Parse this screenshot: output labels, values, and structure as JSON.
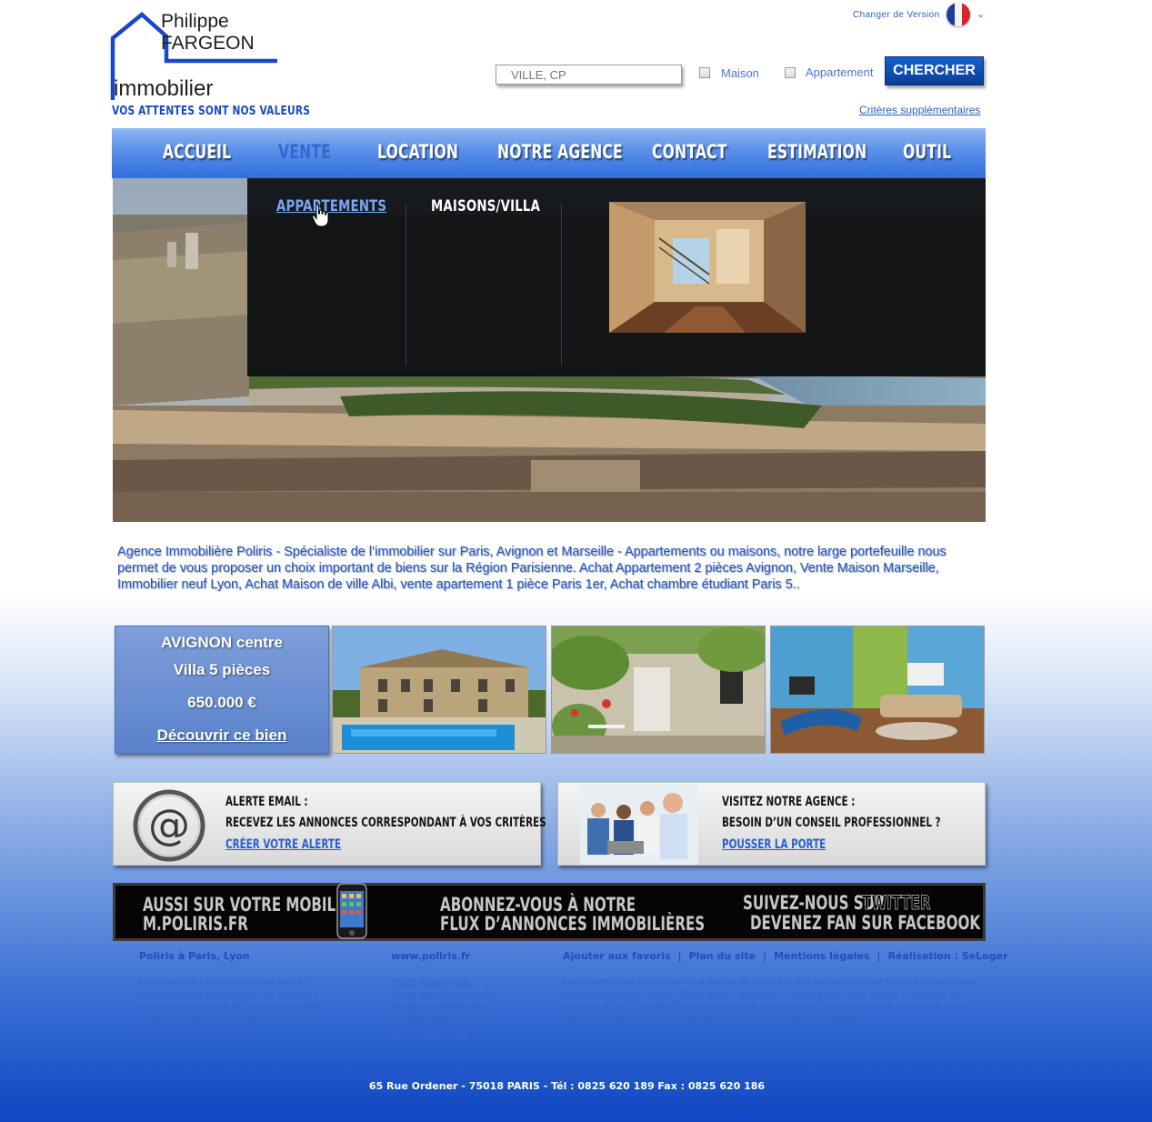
{
  "logo": {
    "line1": "Philippe",
    "line2": "FARGEON",
    "line3": "immobilier"
  },
  "tagline": "VOS ATTENTES SONT NOS VALEURS",
  "header": {
    "change_version": "Changer de Version",
    "language_flag": "france-flag-icon",
    "search_placeholder": "VILLE, CP",
    "check_maison": "Maison",
    "check_appartement": "Appartement",
    "search_button": "CHERCHER",
    "criteria_link": "Critères supplémentaires"
  },
  "nav": {
    "items": [
      {
        "label": "ACCUEIL"
      },
      {
        "label": "VENTE"
      },
      {
        "label": "LOCATION"
      },
      {
        "label": "NOTRE AGENCE"
      },
      {
        "label": "CONTACT"
      },
      {
        "label": "ESTIMATION"
      },
      {
        "label": "OUTIL"
      }
    ],
    "active": "VENTE"
  },
  "dropdown": {
    "item1": "APPARTEMENTS",
    "item2": "MAISONS/VILLA"
  },
  "description": "Agence Immobilière Poliris - Spécialiste de l’immobilier sur Paris, Avignon et Marseille - Appartements ou maisons, notre large portefeuille nous permet de vous proposer un choix important de biens sur la Région Parisienne. Achat Appartement 2 pièces Avignon, Vente Maison Marseille, Immobilier neuf Lyon, Achat Maison de ville Albi, vente apartement 1 pièce Paris 1er, Achat chambre étudiant Paris 5..",
  "featured": {
    "location": "AVIGNON centre",
    "type": "Villa 5 pièces",
    "price": "650.000 €",
    "cta": "Découvrir ce bien"
  },
  "promo_alert": {
    "title": "ALERTE EMAIL :",
    "text": "RECEVEZ LES ANNONCES CORRESPONDANT À VOS CRITÈRES",
    "link": "CRÉER VOTRE ALERTE"
  },
  "promo_agency": {
    "title": "VISITEZ NOTRE AGENCE :",
    "text": "BESOIN D’UN CONSEIL PROFESSIONNEL ?",
    "link": "POUSSER LA PORTE"
  },
  "banner": {
    "mobile_line1": "AUSSI SUR VOTRE  MOBILE",
    "mobile_line2": "M.POLIRIS.FR",
    "rss_line1": "ABONNEZ-VOUS À NOTRE",
    "rss_line2": "FLUX D’ANNONCES IMMOBILIÈRES",
    "social_line1": "SUIVEZ-NOUS SUR",
    "social_twitter": "TWITTER",
    "social_line2": "DEVENEZ FAN SUR FACEBOOK"
  },
  "footer": {
    "col1_title": "Poliris à Paris, Lyon",
    "col1_lines": [
      "Nos annonces immobilières de vente |",
      "Nos annonces immobilières de location |",
      "Nos programmes neufs | Nos nouveautés",
      "| Notre agence UDI | Etimation gratuite |",
      "Nous contacter | Nos outils"
    ],
    "col2_title": "www.poliris.fr",
    "col2_links": [
      "Vente maison ville",
      "Vente appartement ville",
      "Achat immobilier ville",
      "Agence immobiliere ville",
      "Nom agence ville"
    ],
    "links": {
      "favoris": "Ajouter aux favoris",
      "plan": "Plan du site",
      "mentions": "Mentions légales",
      "realisation": "Réalisation : SeLoger"
    },
    "text": "Notre portefeuille immobilier vous permet de consulter des annonces immobilières à Pellentesque consectetuer dui ut mauris. Etiam auctor mauris at mi. Nulla ipsum urna, cursus a, molestie ac, tincidunt at, est. Curabitur ut mauris nec turpis rutrum ultrices. Nullam posuere dui ut risus. Etiam quis diam. Nulla id pede et turpis suscipit mollis...id augue. Sed laoreet.",
    "address": "65 Rue Ordener - 75018 PARIS  -  Tél : 0825 620 189  Fax : 0825 620 186"
  }
}
